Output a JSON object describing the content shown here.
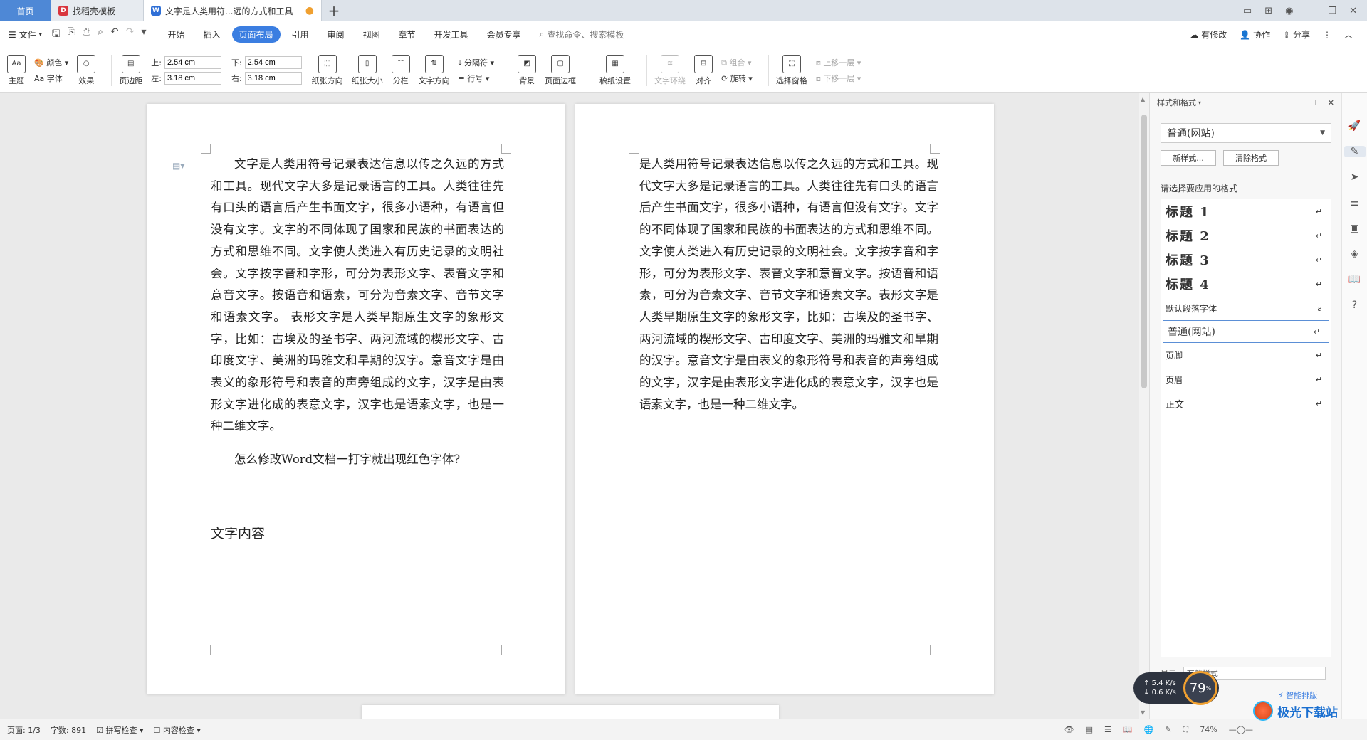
{
  "tabs": [
    {
      "label": "首页",
      "kind": "home"
    },
    {
      "label": "找稻壳模板",
      "kind": "docer"
    },
    {
      "label": "文字是人类用符...远的方式和工具",
      "kind": "doc",
      "modified": true
    }
  ],
  "menubar": {
    "file": "文件",
    "menus": [
      "开始",
      "插入",
      "页面布局",
      "引用",
      "审阅",
      "视图",
      "章节",
      "开发工具",
      "会员专享"
    ],
    "active_menu": "页面布局",
    "search": "查找命令、搜索模板",
    "right": [
      "有修改",
      "协作",
      "分享"
    ]
  },
  "ribbon": {
    "theme": "主题",
    "color": "颜色",
    "font": "Aa 字体",
    "effect": "效果",
    "margins": "页边距",
    "top_label": "上:",
    "top_val": "2.54 cm",
    "bottom_label": "下:",
    "bottom_val": "2.54 cm",
    "left_label": "左:",
    "left_val": "3.18 cm",
    "right_label": "右:",
    "right_val": "3.18 cm",
    "orientation": "纸张方向",
    "size": "纸张大小",
    "columns": "分栏",
    "text_direction": "文字方向",
    "separator": "分隔符",
    "line_no": "行号",
    "background": "背景",
    "page_border": "页面边框",
    "draft": "稿纸设置",
    "wrap": "文字环绕",
    "align": "对齐",
    "group": "组合",
    "rotate": "旋转",
    "select_pane": "选择窗格",
    "bring_forward": "上移一层",
    "send_backward": "下移一层"
  },
  "document": {
    "page1_body": "文字是人类用符号记录表达信息以传之久远的方式和工具。现代文字大多是记录语言的工具。人类往往先有口头的语言后产生书面文字，很多小语种，有语言但没有文字。文字的不同体现了国家和民族的书面表达的方式和思维不同。文字使人类进入有历史记录的文明社会。文字按字音和字形，可分为表形文字、表音文字和意音文字。按语音和语素，可分为音素文字、音节文字和语素文字。 表形文字是人类早期原生文字的象形文字，比如：古埃及的圣书字、两河流域的楔形文字、古印度文字、美洲的玛雅文和早期的汉字。意音文字是由表义的象形符号和表音的声旁组成的文字，汉字是由表形文字进化成的表意文字，汉字也是语素文字，也是一种二维文字。",
    "page1_question": "怎么修改Word文档一打字就出现红色字体?",
    "page1_heading": "文字内容",
    "page2_body": "是人类用符号记录表达信息以传之久远的方式和工具。现代文字大多是记录语言的工具。人类往往先有口头的语言后产生书面文字，很多小语种，有语言但没有文字。文字的不同体现了国家和民族的书面表达的方式和思维不同。文字使人类进入有历史记录的文明社会。文字按字音和字形，可分为表形文字、表音文字和意音文字。按语音和语素，可分为音素文字、音节文字和语素文字。表形文字是人类早期原生文字的象形文字，比如：古埃及的圣书字、两河流域的楔形文字、古印度文字、美洲的玛雅文和早期的汉字。意音文字是由表义的象形符号和表音的声旁组成的文字，汉字是由表形文字进化成的表意文字，汉字也是语素文字，也是一种二维文字。"
  },
  "pane": {
    "title": "样式和格式",
    "current_style": "普通(网站)",
    "new_style": "新样式...",
    "clear_format": "清除格式",
    "choose_label": "请选择要应用的格式",
    "styles": [
      {
        "name": "标题 1",
        "kind": "h1",
        "mark": "↵"
      },
      {
        "name": "标题 2",
        "kind": "h2",
        "mark": "↵"
      },
      {
        "name": "标题 3",
        "kind": "h3",
        "mark": "↵"
      },
      {
        "name": "标题 4",
        "kind": "h4",
        "mark": "↵"
      },
      {
        "name": "默认段落字体",
        "kind": "small",
        "mark": "a"
      },
      {
        "name": "普通(网站)",
        "kind": "sel",
        "mark": "↵"
      },
      {
        "name": "页脚",
        "kind": "small",
        "mark": "↵"
      },
      {
        "name": "页眉",
        "kind": "small",
        "mark": "↵"
      },
      {
        "name": "正文",
        "kind": "normal",
        "mark": "↵"
      }
    ],
    "show_label": "显示:",
    "show_value": "有效样式",
    "smart_layout": "智能排版"
  },
  "status": {
    "page": "页面: 1/3",
    "words": "字数: 891",
    "spell": "拼写检查",
    "content_check": "内容检查",
    "zoom": "74%"
  },
  "speed": {
    "up": "5.4",
    "down": "0.6",
    "unit": "K/s",
    "percent": "79"
  },
  "watermark": "极光下载站"
}
